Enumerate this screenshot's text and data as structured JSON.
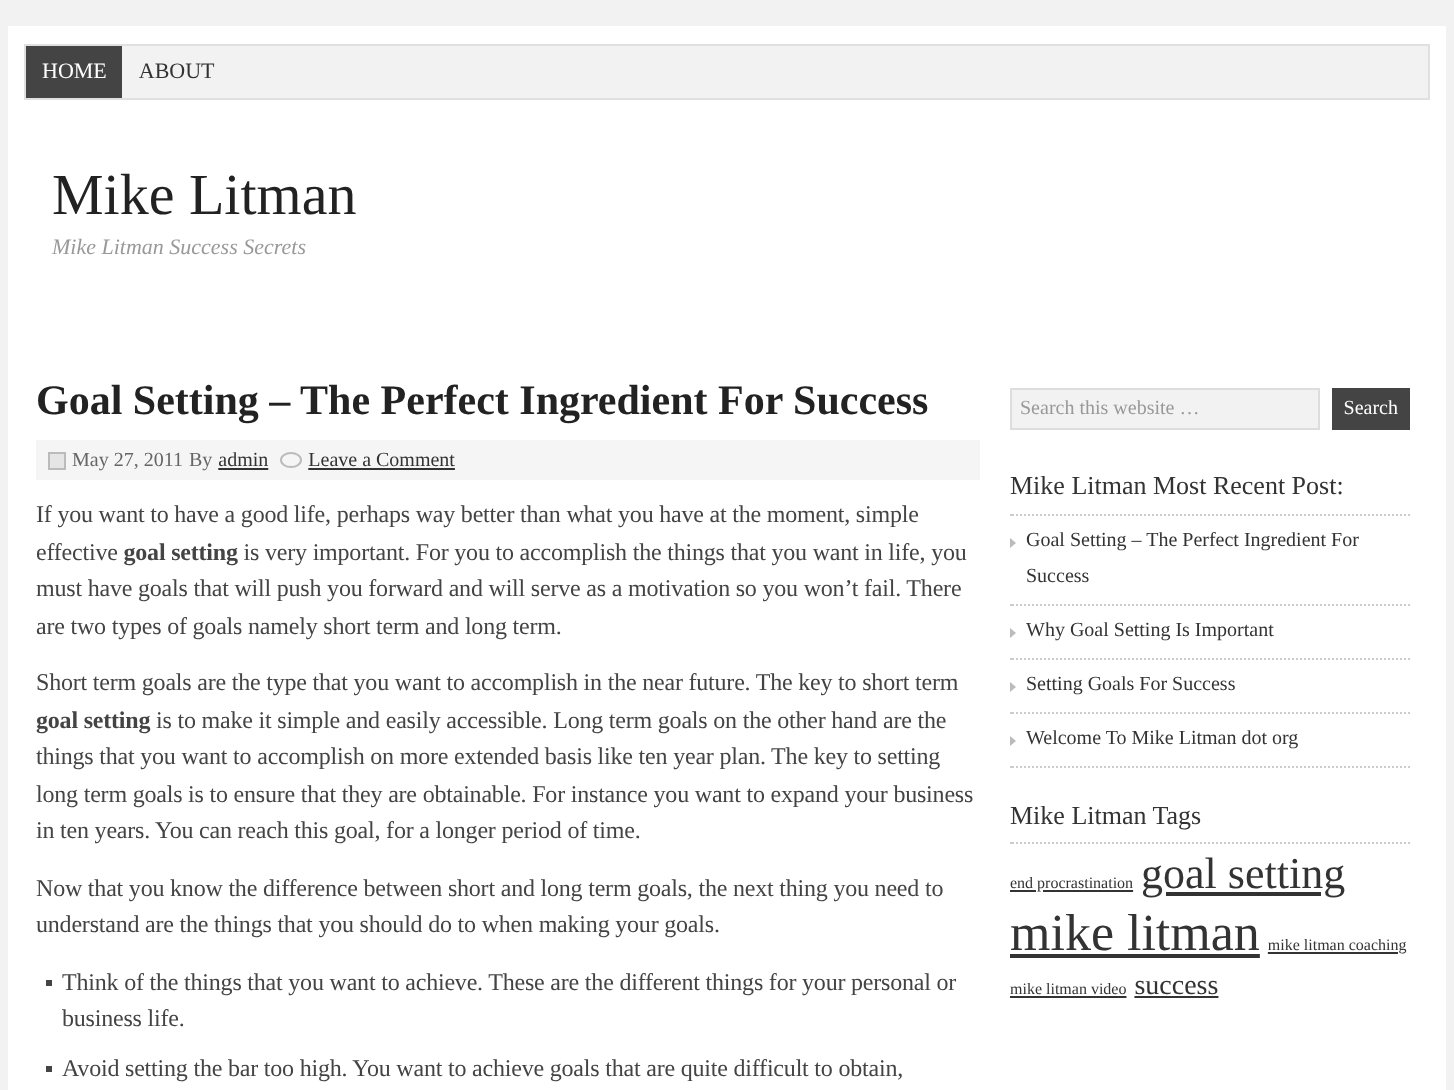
{
  "nav": {
    "items": [
      {
        "label": "HOME",
        "selected": true
      },
      {
        "label": "ABOUT",
        "selected": false
      }
    ]
  },
  "site": {
    "title": "Mike Litman",
    "tagline": "Mike Litman Success Secrets"
  },
  "post": {
    "title": "Goal Setting – The Perfect Ingredient For Success",
    "date": "May 27, 2011",
    "by": "By",
    "author": "admin",
    "comments": "Leave a Comment",
    "paragraphs": [
      "If you want to have a good life, perhaps way better than what you have at the moment, simple effective **goal setting** is very important. For you to accomplish the things that you want in life, you must have goals that will push you forward and will serve as a motivation so you won’t fail. There are two types of goals namely short term and long term.",
      "Short term goals are the type that you want to accomplish in the near future. The key to short term **goal setting** is to make it simple and easily accessible. Long term goals on the other hand are the things that you want to accomplish on more extended basis like ten year plan. The key to setting long term goals is to ensure that they are obtainable. For instance you want to expand your business in ten years. You can reach this goal, for a longer period of time.",
      "Now that you know the difference between short and long term goals, the next thing you need to understand are the things that you should do to when making your goals."
    ],
    "bullets": [
      "Think of the things that you want to achieve. These are the different things for your personal or business life.",
      "Avoid setting the bar too high. You want to achieve goals that are quite difficult to obtain,"
    ]
  },
  "sidebar": {
    "search": {
      "placeholder": "Search this website …",
      "button": "Search"
    },
    "recent": {
      "title": "Mike Litman Most Recent Post:",
      "items": [
        "Goal Setting – The Perfect Ingredient For Success",
        "Why Goal Setting Is Important",
        "Setting Goals For Success",
        "Welcome To Mike Litman dot org"
      ]
    },
    "tags": {
      "title": "Mike Litman Tags",
      "items": [
        {
          "label": "end procrastination",
          "kind": "small"
        },
        {
          "label": "goal setting",
          "kind": "large"
        },
        {
          "label": "mike litman",
          "kind": "huge"
        },
        {
          "label": "mike litman coaching",
          "kind": "small"
        },
        {
          "label": "mike litman video",
          "kind": "small"
        },
        {
          "label": "success",
          "kind": "medium"
        }
      ]
    }
  }
}
